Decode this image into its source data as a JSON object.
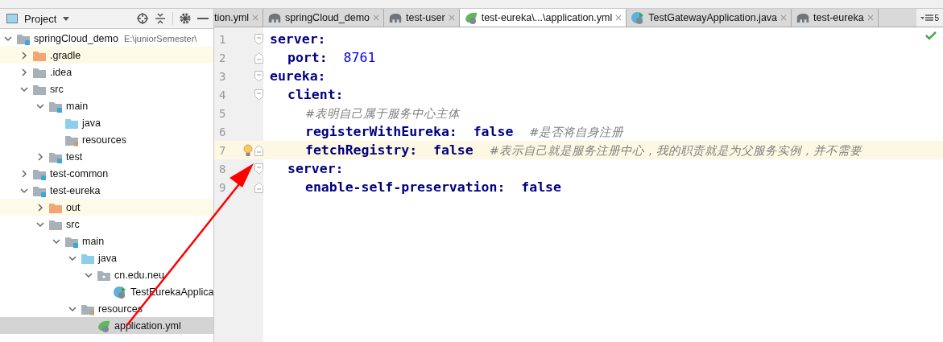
{
  "project_panel": {
    "title": "Project",
    "tree": [
      {
        "label": "springCloud_demo",
        "hint": "E:\\juniorSemester\\",
        "kind": "module",
        "expanded": true,
        "selected": false,
        "children": [
          {
            "label": ".gradle",
            "kind": "excluded",
            "expanded": false,
            "selected": false
          },
          {
            "label": ".idea",
            "kind": "folder",
            "expanded": false,
            "selected": false
          },
          {
            "label": "src",
            "kind": "folder",
            "expanded": true,
            "selected": false,
            "children": [
              {
                "label": "main",
                "kind": "module",
                "expanded": true,
                "selected": false,
                "children": [
                  {
                    "label": "java",
                    "kind": "source",
                    "selected": false
                  },
                  {
                    "label": "resources",
                    "kind": "resources",
                    "selected": false
                  }
                ]
              },
              {
                "label": "test",
                "kind": "module",
                "expanded": false,
                "selected": false
              }
            ]
          },
          {
            "label": "test-common",
            "kind": "module",
            "expanded": false,
            "selected": false
          },
          {
            "label": "test-eureka",
            "kind": "module",
            "expanded": true,
            "selected": false,
            "children": [
              {
                "label": "out",
                "kind": "excluded",
                "expanded": false,
                "selected": false
              },
              {
                "label": "src",
                "kind": "folder",
                "expanded": true,
                "selected": false,
                "children": [
                  {
                    "label": "main",
                    "kind": "module",
                    "expanded": true,
                    "selected": false,
                    "children": [
                      {
                        "label": "java",
                        "kind": "source",
                        "expanded": true,
                        "selected": false,
                        "children": [
                          {
                            "label": "cn.edu.neu",
                            "kind": "package",
                            "expanded": true,
                            "selected": false,
                            "children": [
                              {
                                "label": "TestEurekaApplica",
                                "kind": "spring-class",
                                "selected": false
                              }
                            ]
                          }
                        ]
                      },
                      {
                        "label": "resources",
                        "kind": "resources",
                        "expanded": true,
                        "selected": false,
                        "children": [
                          {
                            "label": "application.yml",
                            "kind": "spring-file",
                            "selected": true
                          }
                        ]
                      }
                    ]
                  }
                ]
              }
            ]
          }
        ]
      }
    ]
  },
  "tabs": [
    {
      "label": "tion.yml",
      "kind": "plain",
      "selected": false
    },
    {
      "label": "springCloud_demo",
      "kind": "gradle",
      "selected": false
    },
    {
      "label": "test-user",
      "kind": "gradle",
      "selected": false
    },
    {
      "label": "test-eureka\\...\\application.yml",
      "kind": "spring-file",
      "selected": true
    },
    {
      "label": "TestGatewayApplication.java",
      "kind": "spring-class",
      "selected": false
    },
    {
      "label": "test-eureka",
      "kind": "gradle",
      "selected": false
    }
  ],
  "hidden_tabs_count": "5",
  "editor": {
    "lines": [
      {
        "number": "1",
        "key": "server:",
        "current": false,
        "children": [
          {
            "number": "2",
            "key": "port:",
            "value": {
              "text": "8761",
              "kind": "number"
            },
            "current": false
          }
        ]
      },
      {
        "number": "3",
        "key": "eureka:",
        "current": false,
        "children": [
          {
            "number": "4",
            "key": "client:",
            "current": false,
            "children": [
              {
                "number": "5",
                "comment": "#表明自己属于服务中心主体",
                "current": false
              },
              {
                "number": "6",
                "key": "registerWithEureka:",
                "value": {
                  "text": "false",
                  "kind": "keyword"
                },
                "comment": "#是否将自身注册",
                "current": false
              },
              {
                "number": "7",
                "key": "fetchRegistry:",
                "value": {
                  "text": "false",
                  "kind": "keyword"
                },
                "comment": " #表示自己就是服务注册中心，我的职责就是为父服务实例，并不需要",
                "current": true
              }
            ]
          },
          {
            "number": "8",
            "key": "server:",
            "current": false,
            "children": [
              {
                "number": "9",
                "key": "enable-self-preservation:",
                "value": {
                  "text": "false",
                  "kind": "keyword"
                },
                "current": false
              }
            ]
          }
        ]
      }
    ]
  }
}
